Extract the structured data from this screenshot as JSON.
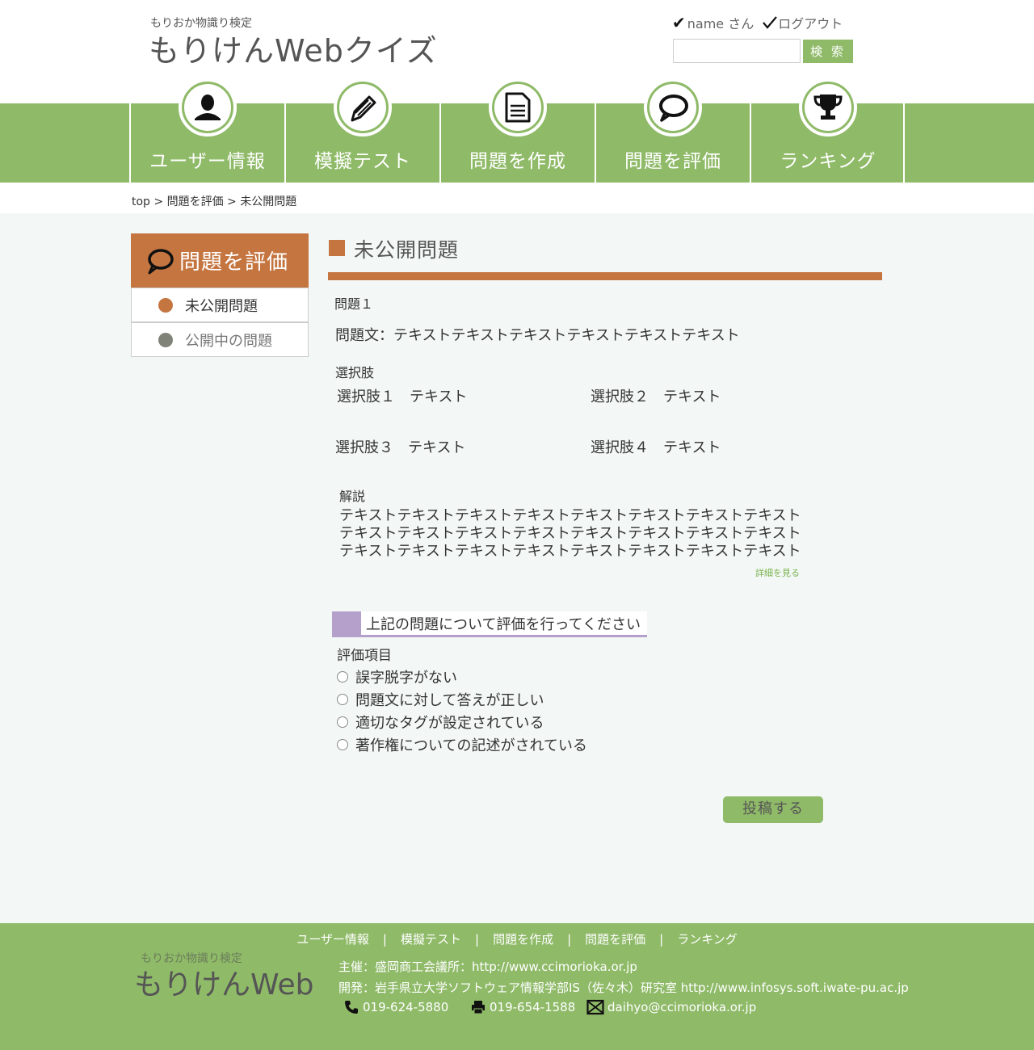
{
  "header": {
    "logo_sub": "もりおか物識り検定",
    "logo_main": "もりけんWebクイズ",
    "user_name": "name さん",
    "logout": "ログアウト",
    "search_placeholder": "",
    "search_button": "検 索"
  },
  "nav": {
    "items": [
      {
        "label": "ユーザー情報",
        "icon": "user-icon"
      },
      {
        "label": "模擬テスト",
        "icon": "pencil-icon"
      },
      {
        "label": "問題を作成",
        "icon": "document-icon"
      },
      {
        "label": "問題を評価",
        "icon": "speech-bubble-icon"
      },
      {
        "label": "ランキング",
        "icon": "trophy-icon"
      }
    ]
  },
  "breadcrumb": "top > 問題を評価 > 未公開問題",
  "sidebar": {
    "title": "問題を評価",
    "items": [
      {
        "label": "未公開問題",
        "color": "#c57540",
        "active": true
      },
      {
        "label": "公開中の問題",
        "color": "#7f8377",
        "active": false
      }
    ]
  },
  "main": {
    "title": "未公開問題",
    "question_number": "問題１",
    "question_text": "問題文：テキストテキストテキストテキストテキストテキスト",
    "choices_label": "選択肢",
    "choices": [
      {
        "label": "選択肢１",
        "text": "テキスト"
      },
      {
        "label": "選択肢２",
        "text": "テキスト"
      },
      {
        "label": "選択肢３",
        "text": "テキスト"
      },
      {
        "label": "選択肢４",
        "text": "テキスト"
      }
    ],
    "explanation_label": "解説",
    "explanation_lines": [
      "テキストテキストテキストテキストテキストテキストテキストテキスト",
      "テキストテキストテキストテキストテキストテキストテキストテキスト",
      "テキストテキストテキストテキストテキストテキストテキストテキスト"
    ],
    "more_link": "詳細を見る",
    "eval_heading": "上記の問題について評価を行ってください",
    "eval_items_label": "評価項目",
    "eval_items": [
      "誤字脱字がない",
      "問題文に対して答えが正しい",
      "適切なタグが設定されている",
      "著作権についての記述がされている"
    ],
    "submit": "投稿する"
  },
  "footer": {
    "nav": [
      "ユーザー情報",
      "模擬テスト",
      "問題を作成",
      "問題を評価",
      "ランキング"
    ],
    "separator": "|",
    "logo_sub": "もりおか物識り検定",
    "logo_main": "もりけんWeb",
    "sponsor": "主催：盛岡商工会議所：http://www.ccimorioka.or.jp",
    "developer": "開発：岩手県立大学ソフトウェア情報学部IS（佐々木）研究室  http://www.infosys.soft.iwate-pu.ac.jp",
    "phone": "019-624-5880",
    "fax": "019-654-1588",
    "email": "daihyo@ccimorioka.or.jp"
  },
  "colors": {
    "green": "#8fba68",
    "orange": "#c57540",
    "purple": "#b59fcb",
    "link_green": "#7ab34c"
  }
}
